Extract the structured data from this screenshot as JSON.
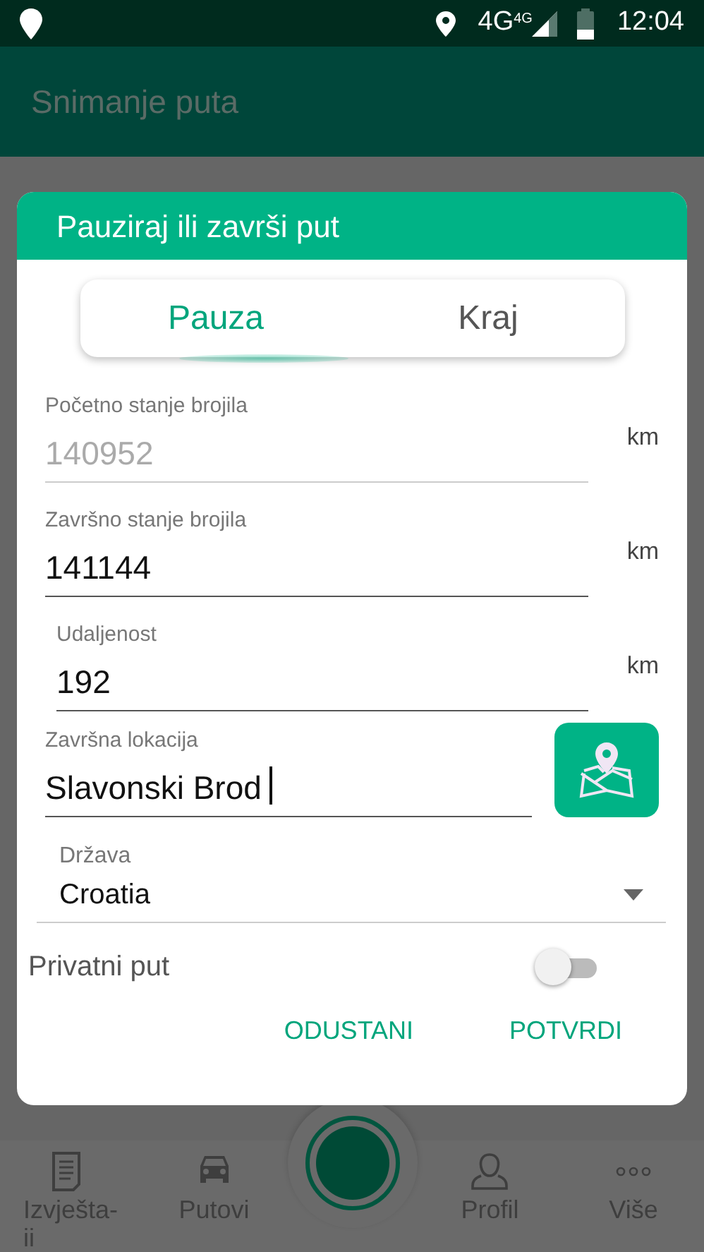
{
  "status_bar": {
    "time": "12:04",
    "network": "4G",
    "network_small": "4G"
  },
  "app_bar": {
    "title": "Snimanje puta"
  },
  "dialog": {
    "title": "Pauziraj ili završi put",
    "tabs": [
      {
        "label": "Pauza",
        "selected": true
      },
      {
        "label": "Kraj",
        "selected": false
      }
    ],
    "fields": [
      {
        "label": "Početno stanje brojila",
        "value": "140952",
        "unit": "km",
        "disabled": true
      },
      {
        "label": "Završno stanje brojila",
        "value": "141144",
        "unit": "km",
        "disabled": false
      },
      {
        "label": "Udaljenost",
        "value": "192",
        "unit": "km",
        "disabled": false
      }
    ],
    "location": {
      "label": "Završna lokacija",
      "value": "Slavonski Brod",
      "focused": true
    },
    "country": {
      "label": "Država",
      "value": "Croatia"
    },
    "private_trip": {
      "label": "Privatni put",
      "on": false
    },
    "buttons": [
      "ODUSTANI",
      "POTVRDI"
    ]
  },
  "bottom_nav": [
    {
      "label": "Izvješta-\nii",
      "kind": "document"
    },
    {
      "label": "Putovi",
      "kind": "car"
    },
    {
      "kind": "record"
    },
    {
      "label": "Profil",
      "kind": "person"
    },
    {
      "label": "Više",
      "kind": "more"
    }
  ]
}
